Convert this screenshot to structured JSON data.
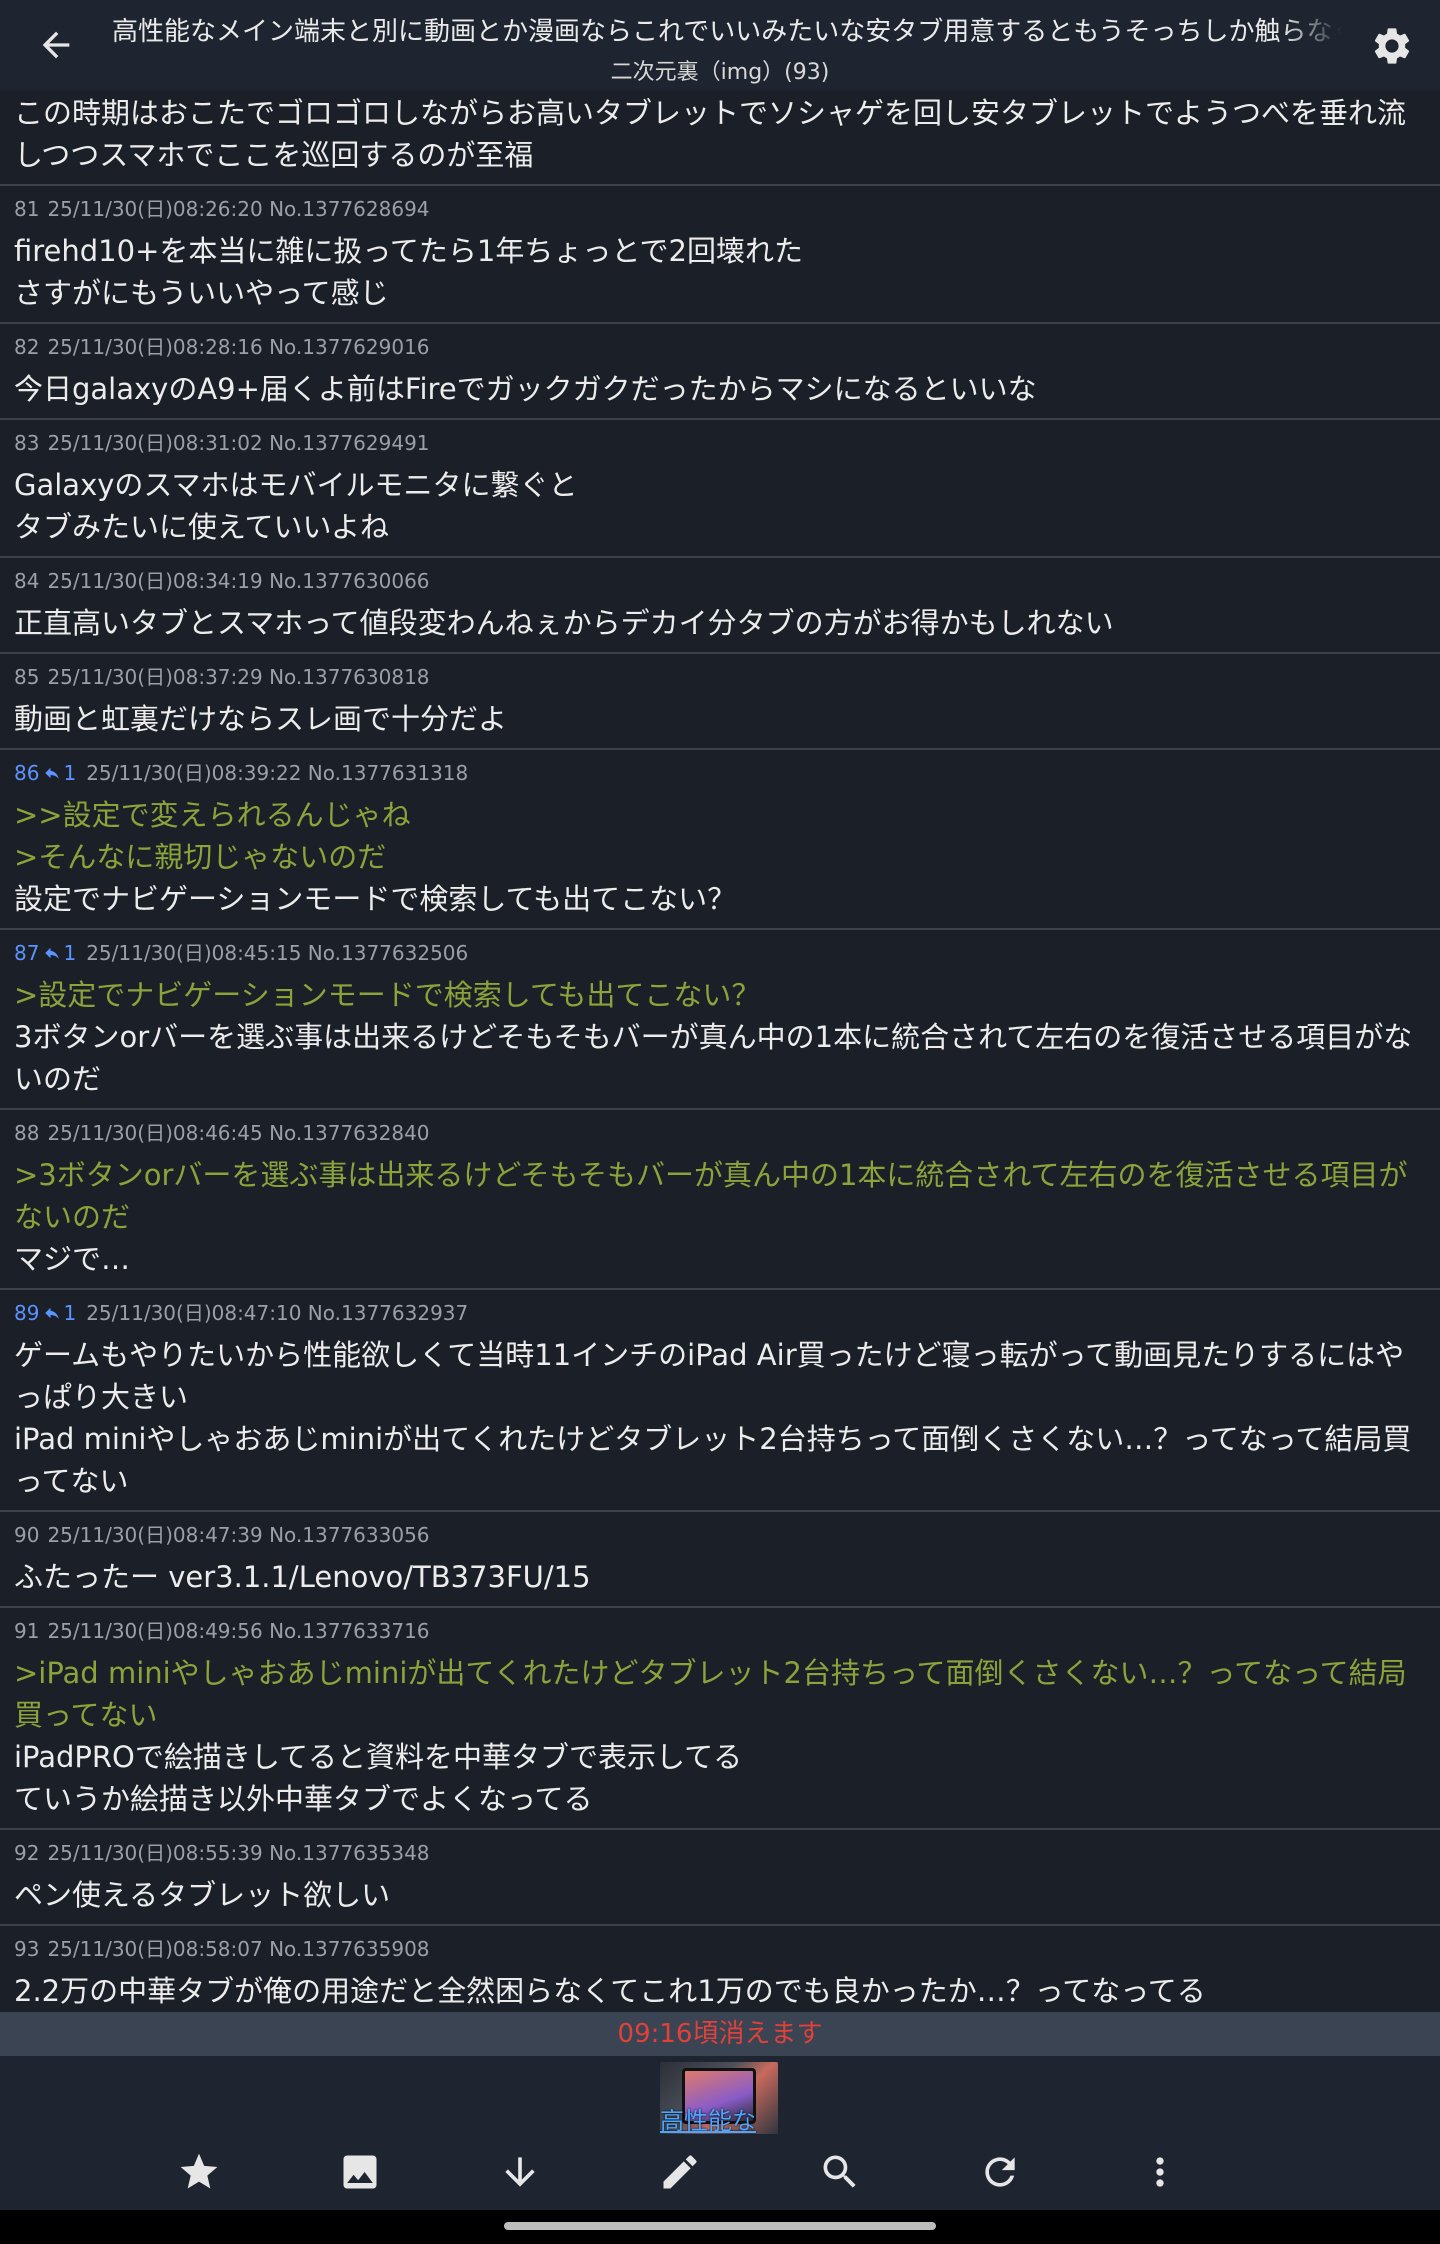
{
  "header": {
    "title": "高性能なメイン端末と別に動画とか漫画ならこれでいいみたいな安タブ用意するともうそっちしか触らなくな",
    "subtitle": "二次元裏（img）(93)"
  },
  "posts": [
    {
      "lines": [
        {
          "t": "この時期はおこたでゴロゴロしながらお高いタブレットでソシャゲを回し安タブレットでようつべを垂れ流",
          "q": false
        },
        {
          "t": "しつつスマホでここを巡回するのが至福",
          "q": false
        }
      ]
    },
    {
      "num": "81",
      "meta": "25/11/30(日)08:26:20 No.1377628694",
      "lines": [
        {
          "t": "firehd10+を本当に雑に扱ってたら1年ちょっとで2回壊れた",
          "q": false
        },
        {
          "t": "さすがにもういいやって感じ",
          "q": false
        }
      ]
    },
    {
      "num": "82",
      "meta": "25/11/30(日)08:28:16 No.1377629016",
      "lines": [
        {
          "t": "今日galaxyのA9+届くよ前はFireでガックガクだったからマシになるといいな",
          "q": false
        }
      ]
    },
    {
      "num": "83",
      "meta": "25/11/30(日)08:31:02 No.1377629491",
      "lines": [
        {
          "t": "Galaxyのスマホはモバイルモニタに繋ぐと",
          "q": false
        },
        {
          "t": "タブみたいに使えていいよね",
          "q": false
        }
      ]
    },
    {
      "num": "84",
      "meta": "25/11/30(日)08:34:19 No.1377630066",
      "lines": [
        {
          "t": "正直高いタブとスマホって値段変わんねぇからデカイ分タブの方がお得かもしれない",
          "q": false
        }
      ]
    },
    {
      "num": "85",
      "meta": "25/11/30(日)08:37:29 No.1377630818",
      "lines": [
        {
          "t": "動画と虹裏だけならスレ画で十分だよ",
          "q": false
        }
      ]
    },
    {
      "num": "86",
      "replies": "1",
      "meta": "25/11/30(日)08:39:22 No.1377631318",
      "lines": [
        {
          "t": ">>設定で変えられるんじゃね",
          "q": true
        },
        {
          "t": ">そんなに親切じゃないのだ",
          "q": true
        },
        {
          "t": "設定でナビゲーションモードで検索しても出てこない？",
          "q": false
        }
      ]
    },
    {
      "num": "87",
      "replies": "1",
      "meta": "25/11/30(日)08:45:15 No.1377632506",
      "lines": [
        {
          "t": ">設定でナビゲーションモードで検索しても出てこない？",
          "q": true
        },
        {
          "t": "3ボタンorバーを選ぶ事は出来るけどそもそもバーが真ん中の1本に統合されて左右のを復活させる項目がな",
          "q": false
        },
        {
          "t": "いのだ",
          "q": false
        }
      ]
    },
    {
      "num": "88",
      "meta": "25/11/30(日)08:46:45 No.1377632840",
      "lines": [
        {
          "t": ">3ボタンorバーを選ぶ事は出来るけどそもそもバーが真ん中の1本に統合されて左右のを復活させる項目が",
          "q": true
        },
        {
          "t": "ないのだ",
          "q": true
        },
        {
          "t": "マジで…",
          "q": false
        }
      ]
    },
    {
      "num": "89",
      "replies": "1",
      "meta": "25/11/30(日)08:47:10 No.1377632937",
      "lines": [
        {
          "t": "ゲームもやりたいから性能欲しくて当時11インチのiPad Air買ったけど寝っ転がって動画見たりするにはや",
          "q": false
        },
        {
          "t": "っぱり大きい",
          "q": false
        },
        {
          "t": "iPad miniやしゃおあじminiが出てくれたけどタブレット2台持ちって面倒くさくない…？ってなって結局買",
          "q": false
        },
        {
          "t": "ってない",
          "q": false
        }
      ]
    },
    {
      "num": "90",
      "meta": "25/11/30(日)08:47:39 No.1377633056",
      "lines": [
        {
          "t": "ふたったー ver3.1.1/Lenovo/TB373FU/15",
          "q": false
        }
      ]
    },
    {
      "num": "91",
      "meta": "25/11/30(日)08:49:56 No.1377633716",
      "lines": [
        {
          "t": ">iPad miniやしゃおあじminiが出てくれたけどタブレット2台持ちって面倒くさくない…？ってなって結局",
          "q": true
        },
        {
          "t": "買ってない",
          "q": true
        },
        {
          "t": "iPadPROで絵描きしてると資料を中華タブで表示してる",
          "q": false
        },
        {
          "t": "ていうか絵描き以外中華タブでよくなってる",
          "q": false
        }
      ]
    },
    {
      "num": "92",
      "meta": "25/11/30(日)08:55:39 No.1377635348",
      "lines": [
        {
          "t": "ペン使えるタブレット欲しい",
          "q": false
        }
      ]
    },
    {
      "num": "93",
      "meta": "25/11/30(日)08:58:07 No.1377635908",
      "lines": [
        {
          "t": "2.2万の中華タブが俺の用途だと全然困らなくてこれ1万のでも良かったか…？ってなってる",
          "q": false
        }
      ]
    }
  ],
  "expire": "09:16頃消えます",
  "thumb_label": "高性能な",
  "colors": {
    "background": "#1b1f27",
    "quote": "#8aa33a",
    "reply_number": "#5b93ff",
    "expire_text": "#e0413a",
    "thumb_link": "#4aa6ff"
  },
  "toolbar": [
    {
      "name": "favorite-star-icon"
    },
    {
      "name": "image-icon"
    },
    {
      "name": "scroll-down-icon"
    },
    {
      "name": "edit-pencil-icon"
    },
    {
      "name": "search-icon"
    },
    {
      "name": "refresh-icon"
    },
    {
      "name": "more-vert-icon"
    }
  ]
}
